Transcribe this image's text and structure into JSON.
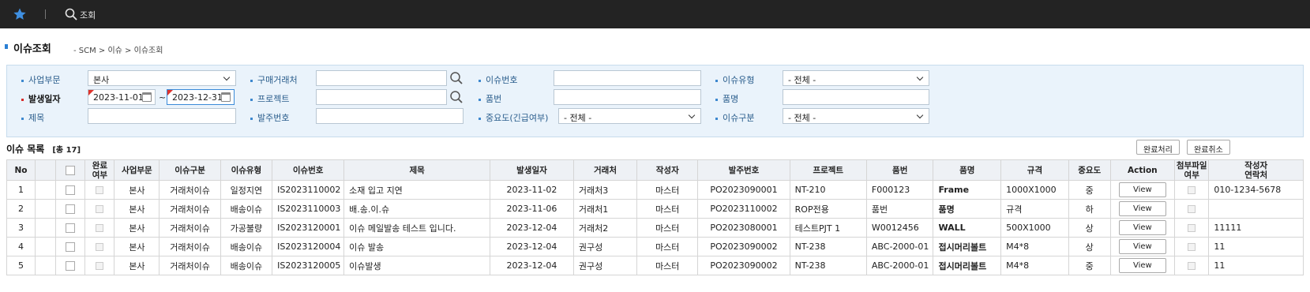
{
  "topbar": {
    "search_label": "조회"
  },
  "page": {
    "title": "이슈조회",
    "breadcrumb": "- SCM > 이슈 > 이슈조회"
  },
  "filters": {
    "business_unit": {
      "label": "사업부문",
      "value": "본사"
    },
    "vendor": {
      "label": "구매거래처",
      "value": ""
    },
    "issue_no": {
      "label": "이슈번호",
      "value": ""
    },
    "issue_type": {
      "label": "이슈유형",
      "value": "- 전체 -"
    },
    "date": {
      "label": "발생일자",
      "from": "2023-11-01",
      "sep": "~",
      "to": "2023-12-31"
    },
    "project": {
      "label": "프로젝트",
      "value": ""
    },
    "part_no": {
      "label": "품번",
      "value": ""
    },
    "part_name": {
      "label": "품명",
      "value": ""
    },
    "subject": {
      "label": "제목",
      "value": ""
    },
    "po_no": {
      "label": "발주번호",
      "value": ""
    },
    "importance": {
      "label": "중요도(긴급여부)",
      "value": "- 전체 -"
    },
    "issue_class": {
      "label": "이슈구분",
      "value": "- 전체 -"
    }
  },
  "list": {
    "title": "이슈 목록",
    "count": "[총 17]",
    "complete_btn": "완료처리",
    "cancel_btn": "완료취소",
    "columns": [
      "No",
      "",
      "",
      "완료\n여부",
      "사업부문",
      "이슈구분",
      "이슈유형",
      "이슈번호",
      "제목",
      "발생일자",
      "거래처",
      "작성자",
      "발주번호",
      "프로젝트",
      "품번",
      "품명",
      "규격",
      "중요도",
      "Action",
      "첨부파일\n여부",
      "작성자\n연락처"
    ],
    "rows": [
      {
        "no": "1",
        "bu": "본사",
        "cls": "거래처이슈",
        "type": "일정지연",
        "issue_no": "IS2023110002",
        "subject": "소재 입고 지연",
        "date": "2023-11-02",
        "vendor": "거래처3",
        "author": "마스터",
        "po": "PO2023090001",
        "project": "NT-210",
        "part_no": "F000123",
        "part_name": "Frame",
        "spec": "1000X1000",
        "imp": "중",
        "action": "View",
        "phone": "010-1234-5678"
      },
      {
        "no": "2",
        "bu": "본사",
        "cls": "거래처이슈",
        "type": "배송이슈",
        "issue_no": "IS2023110003",
        "subject": "배.송.이.슈",
        "date": "2023-11-06",
        "vendor": "거래처1",
        "author": "마스터",
        "po": "PO2023110002",
        "project": "ROP전용",
        "part_no": "품번",
        "part_name": "품명",
        "spec": "규격",
        "imp": "하",
        "action": "View",
        "phone": ""
      },
      {
        "no": "3",
        "bu": "본사",
        "cls": "거래처이슈",
        "type": "가공불량",
        "issue_no": "IS2023120001",
        "subject": "이슈 메일발송 테스트 입니다.",
        "date": "2023-12-04",
        "vendor": "거래처2",
        "author": "마스터",
        "po": "PO2023080001",
        "project": "테스트PJT 1",
        "part_no": "W0012456",
        "part_name": "WALL",
        "spec": "500X1000",
        "imp": "상",
        "action": "View",
        "phone": "11111"
      },
      {
        "no": "4",
        "bu": "본사",
        "cls": "거래처이슈",
        "type": "배송이슈",
        "issue_no": "IS2023120004",
        "subject": "이슈 발송",
        "date": "2023-12-04",
        "vendor": "권구성",
        "author": "마스터",
        "po": "PO2023090002",
        "project": "NT-238",
        "part_no": "ABC-2000-01",
        "part_name": "접시머리볼트",
        "spec": "M4*8",
        "imp": "상",
        "action": "View",
        "phone": "11"
      },
      {
        "no": "5",
        "bu": "본사",
        "cls": "거래처이슈",
        "type": "배송이슈",
        "issue_no": "IS2023120005",
        "subject": "이슈발생",
        "date": "2023-12-04",
        "vendor": "권구성",
        "author": "마스터",
        "po": "PO2023090002",
        "project": "NT-238",
        "part_no": "ABC-2000-01",
        "part_name": "접시머리볼트",
        "spec": "M4*8",
        "imp": "중",
        "action": "View",
        "phone": "11"
      }
    ]
  }
}
